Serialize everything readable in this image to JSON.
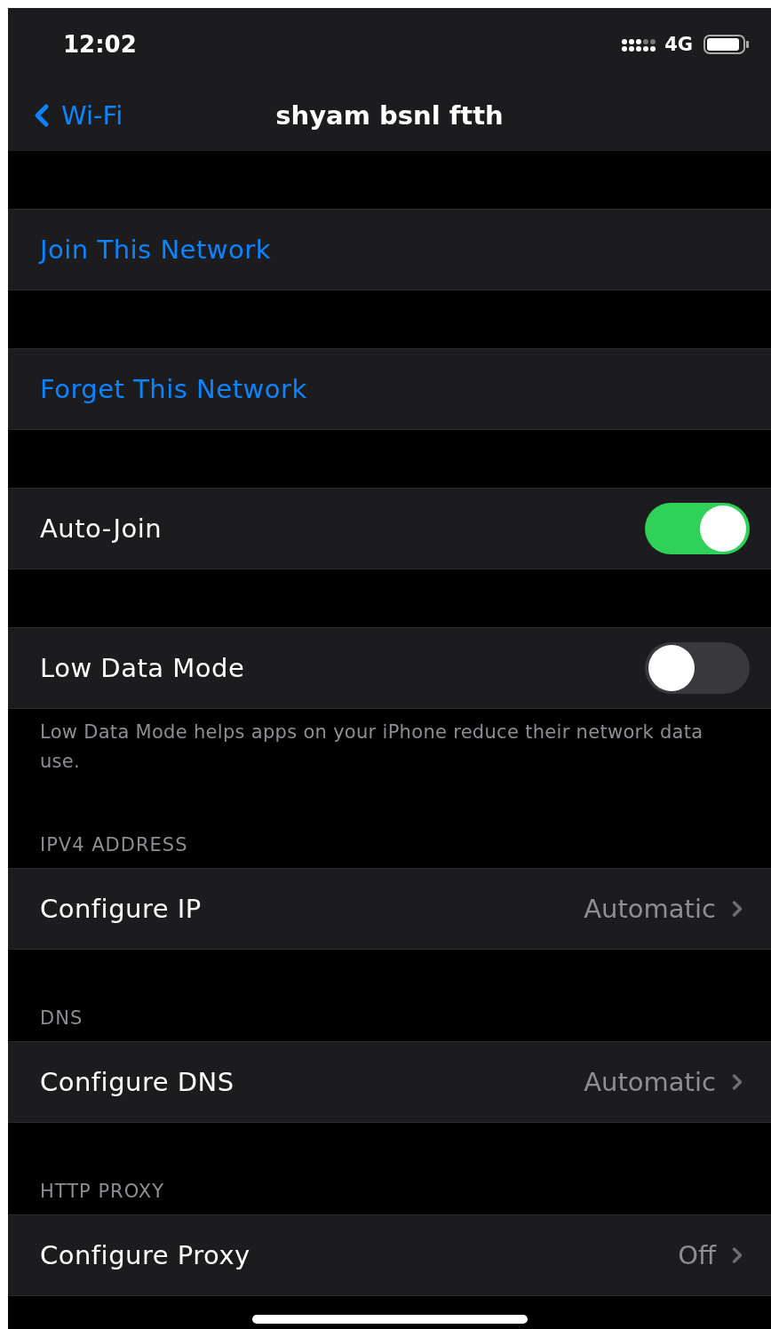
{
  "status_bar": {
    "time": "12:02",
    "network": "4G"
  },
  "nav": {
    "back": "Wi-Fi",
    "title": "shyam bsnl ftth"
  },
  "sections": [
    {
      "rows": [
        {
          "kind": "action",
          "label": "Join This Network"
        }
      ]
    },
    {
      "rows": [
        {
          "kind": "action",
          "label": "Forget This Network"
        }
      ]
    },
    {
      "rows": [
        {
          "kind": "toggle",
          "label": "Auto-Join",
          "on": true
        }
      ]
    },
    {
      "rows": [
        {
          "kind": "toggle",
          "label": "Low Data Mode",
          "on": false
        }
      ],
      "footer": "Low Data Mode helps apps on your iPhone reduce their network data use."
    },
    {
      "header": "IPV4 ADDRESS",
      "rows": [
        {
          "kind": "detail",
          "label": "Configure IP",
          "value": "Automatic"
        }
      ]
    },
    {
      "header": "DNS",
      "rows": [
        {
          "kind": "detail",
          "label": "Configure DNS",
          "value": "Automatic"
        }
      ]
    },
    {
      "header": "HTTP PROXY",
      "rows": [
        {
          "kind": "detail",
          "label": "Configure Proxy",
          "value": "Off"
        }
      ]
    }
  ]
}
